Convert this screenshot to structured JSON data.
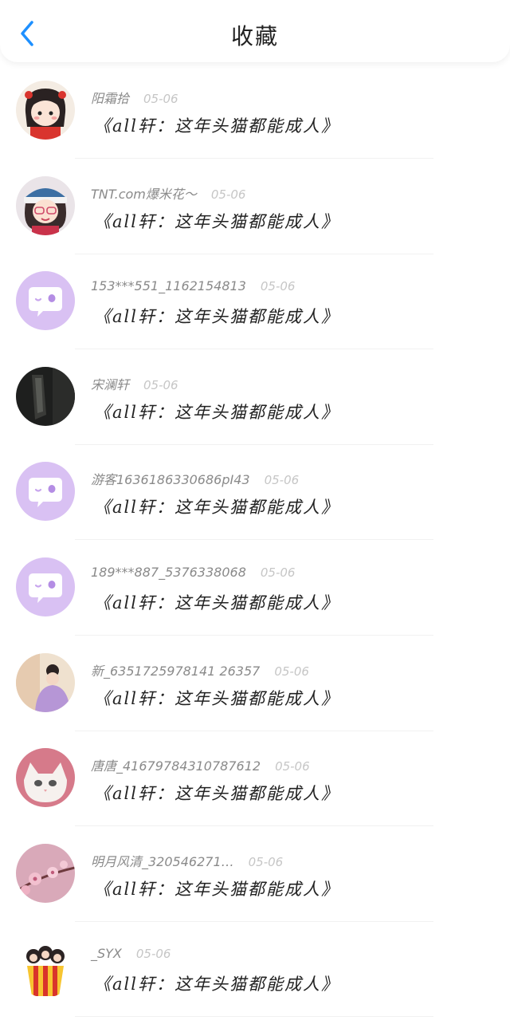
{
  "header": {
    "title": "收藏",
    "back_icon": "chevron-left-icon",
    "accent": "#1e90ff"
  },
  "items": [
    {
      "user": "阳霜拾",
      "date": "05-06",
      "text": "《all轩：这年头猫都能成人》",
      "avatar": "cartoon-girl"
    },
    {
      "user": "TNT.com爆米花～",
      "date": "05-06",
      "text": "《all轩：这年头猫都能成人》",
      "avatar": "cartoon-girl-hat"
    },
    {
      "user": "153***551_1162154813",
      "date": "05-06",
      "text": "《all轩：这年头猫都能成人》",
      "avatar": "default-chat"
    },
    {
      "user": "宋澜轩",
      "date": "05-06",
      "text": "《all轩：这年头猫都能成人》",
      "avatar": "dark-photo"
    },
    {
      "user": "游客1636186330686pI43",
      "date": "05-06",
      "text": "《all轩：这年头猫都能成人》",
      "avatar": "default-chat"
    },
    {
      "user": "189***887_5376338068",
      "date": "05-06",
      "text": "《all轩：这年头猫都能成人》",
      "avatar": "default-chat"
    },
    {
      "user": "新_6351725978141 26357",
      "date": "05-06",
      "text": "《all轩：这年头猫都能成人》",
      "avatar": "purple-hoodie"
    },
    {
      "user": "唐唐_41679784310787612",
      "date": "05-06",
      "text": "《all轩：这年头猫都能成人》",
      "avatar": "white-cat"
    },
    {
      "user": "明月风清_320546271…",
      "date": "05-06",
      "text": "《all轩：这年头猫都能成人》",
      "avatar": "pink-flowers"
    },
    {
      "user": "_SYX",
      "date": "05-06",
      "text": "《all轩：这年头猫都能成人》",
      "avatar": "popcorn"
    }
  ],
  "colors": {
    "default_avatar_bg": "#d9c1f3",
    "default_avatar_fg": "#ffffff",
    "username": "#8a8a8a",
    "date": "#c6c6c6"
  }
}
